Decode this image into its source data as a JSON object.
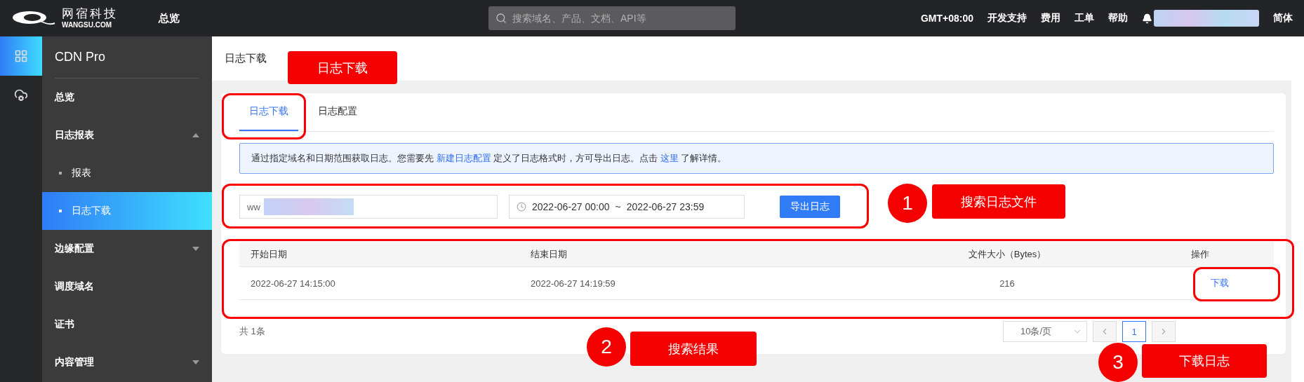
{
  "topbar": {
    "logo_cn": "网宿科技",
    "logo_en": "WANGSU.COM",
    "nav": "总览",
    "search": {
      "placeholder": "搜索域名、产品、文档、API等"
    },
    "links": [
      "GMT+08:00",
      "开发支持",
      "费用",
      "工单",
      "帮助"
    ],
    "language": "简体"
  },
  "rail": [
    {
      "kind": "grid",
      "selected": true
    },
    {
      "kind": "cloud",
      "selected": false
    }
  ],
  "sidebar": {
    "title": "CDN Pro",
    "items": [
      {
        "label": "总览",
        "selected": false
      },
      {
        "label": "日志报表",
        "selected": false,
        "expanded": true,
        "children": [
          {
            "label": "报表",
            "selected": false
          },
          {
            "label": "日志下载",
            "selected": true
          }
        ]
      },
      {
        "label": "边缘配置",
        "selected": false,
        "expanded": false
      },
      {
        "label": "调度域名",
        "selected": false
      },
      {
        "label": "证书",
        "selected": false
      },
      {
        "label": "内容管理",
        "selected": false,
        "expanded": false
      }
    ]
  },
  "page_title": "日志下载",
  "tabs": [
    {
      "label": "日志下载",
      "selected": true
    },
    {
      "label": "日志配置",
      "selected": false
    }
  ],
  "notice": [
    {
      "kind": "text",
      "text": "通过指定域名和日期范围获取日志。您需要先 "
    },
    {
      "kind": "link",
      "text": "新建日志配置"
    },
    {
      "kind": "text",
      "text": " 定义了日志格式时，方可导出日志。点击 "
    },
    {
      "kind": "link",
      "text": "这里"
    },
    {
      "kind": "text",
      "text": " 了解详情。"
    }
  ],
  "filters": {
    "domain": {
      "value": "ww"
    },
    "date_range": {
      "start": "2022-06-27 00:00",
      "separator": "~",
      "end": "2022-06-27 23:59"
    },
    "button": "导出日志"
  },
  "table": {
    "columns": [
      "开始日期",
      "结束日期",
      "文件大小（Bytes）",
      "操作"
    ],
    "rows": [
      [
        "2022-06-27 14:15:00",
        "2022-06-27 14:19:59",
        "216",
        "下载"
      ]
    ]
  },
  "footer": {
    "total": "共 1条",
    "page_size": "10条/页",
    "pages": [
      {
        "label": "1",
        "selected": true
      }
    ]
  },
  "annotations": [
    {
      "kind": "frame"
    },
    {
      "kind": "frame"
    },
    {
      "kind": "frame"
    },
    {
      "kind": "frame"
    },
    {
      "kind": "label",
      "text": "日志下载"
    },
    {
      "kind": "numbered",
      "number": "1",
      "text": "搜索日志文件"
    },
    {
      "kind": "numbered",
      "number": "2",
      "text": "搜索结果"
    },
    {
      "kind": "numbered",
      "number": "3",
      "text": "下载日志"
    }
  ]
}
